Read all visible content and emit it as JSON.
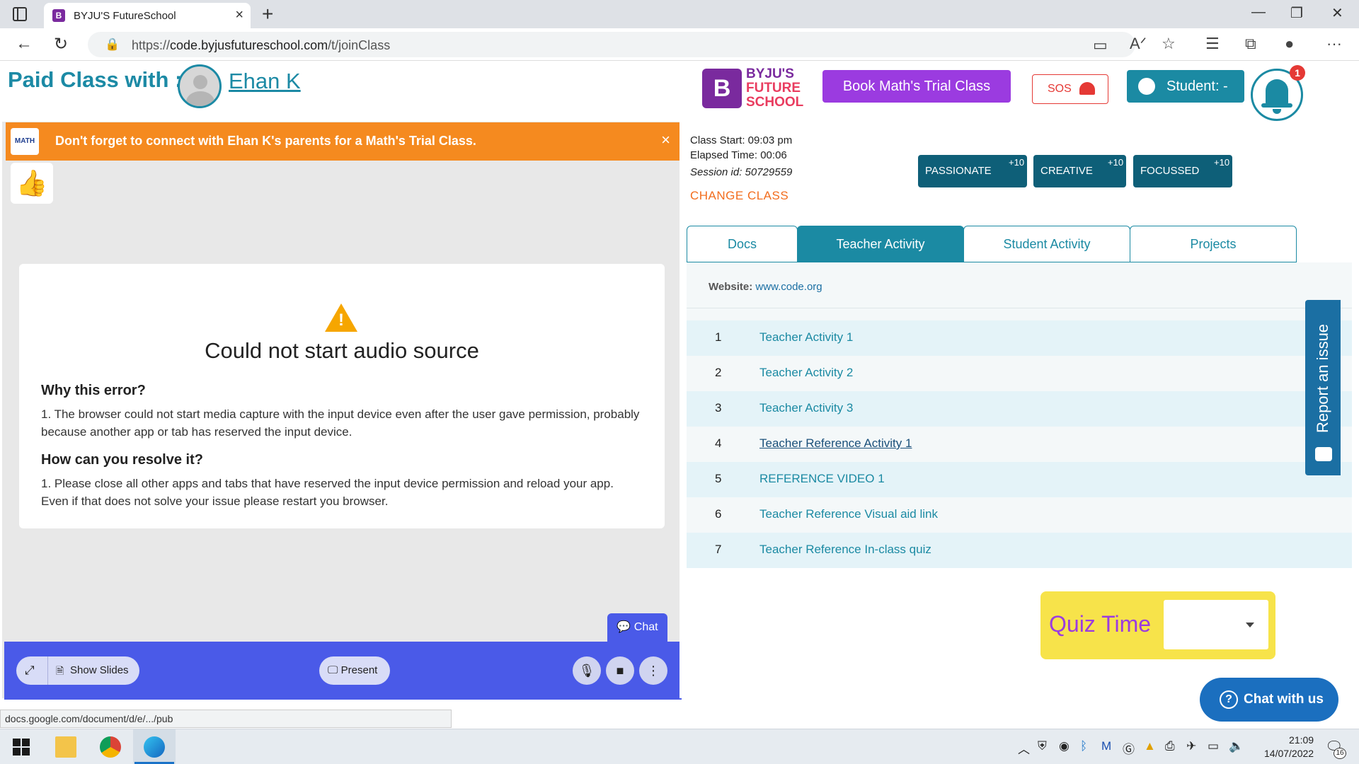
{
  "browser": {
    "tab_title": "BYJU'S FutureSchool",
    "tab_favicon_letter": "B",
    "tab_close": "×",
    "new_tab": "+",
    "url_scheme": "https://",
    "url_host": "code.byjusfutureschool.com",
    "url_path": "/t/joinClass",
    "status_url": "docs.google.com/document/d/e/.../pub"
  },
  "header": {
    "paid_class_label": "Paid Class with :",
    "student_name": "Ehan K",
    "logo_text_line1": "BYJU'S",
    "logo_text_line2": "FUTURE",
    "logo_text_line3": "SCHOOL",
    "logo_letter": "B",
    "book_trial_label": "Book Math's Trial Class",
    "sos_label": "SOS",
    "student_label": "Student: -",
    "notification_count": "1"
  },
  "banner": {
    "badge_text": "MATH",
    "message": "Don't forget to connect with Ehan K's parents for a Math's Trial Class.",
    "close": "×"
  },
  "reaction": "👍",
  "error_card": {
    "title": "Could not start audio source",
    "why_heading": "Why this error?",
    "why_text": "1. The browser could not start media capture with the input device even after the user gave permission, probably because another app or tab has reserved the input device.",
    "resolve_heading": "How can you resolve it?",
    "resolve_text": "1. Please close all other apps and tabs that have reserved the input device permission and reload your app. Even if that does not solve your issue please restart you browser."
  },
  "bottom_bar": {
    "chat_label": "Chat",
    "show_slides_label": "Show Slides",
    "present_label": "Present"
  },
  "class_info": {
    "class_start": "Class Start: 09:03 pm",
    "elapsed_time": "Elapsed Time: 00:06",
    "session_id": "Session id: 50729559",
    "change_class": "CHANGE CLASS"
  },
  "badges": [
    {
      "label": "PASSIONATE",
      "plus": "+10"
    },
    {
      "label": "CREATIVE",
      "plus": "+10"
    },
    {
      "label": "FOCUSSED",
      "plus": "+10"
    }
  ],
  "tabs": [
    {
      "label": "Docs",
      "active": false
    },
    {
      "label": "Teacher Activity",
      "active": true
    },
    {
      "label": "Student Activity",
      "active": false
    },
    {
      "label": "Projects",
      "active": false
    }
  ],
  "activity_panel": {
    "website_label": "Website:",
    "website_value": "www.code.org",
    "rows": [
      {
        "num": "1",
        "label": "Teacher Activity 1"
      },
      {
        "num": "2",
        "label": "Teacher Activity 2"
      },
      {
        "num": "3",
        "label": "Teacher Activity 3"
      },
      {
        "num": "4",
        "label": "Teacher Reference Activity 1"
      },
      {
        "num": "5",
        "label": "REFERENCE VIDEO 1"
      },
      {
        "num": "6",
        "label": "Teacher Reference Visual aid link"
      },
      {
        "num": "7",
        "label": "Teacher Reference In-class quiz"
      }
    ]
  },
  "report_issue": "Report an issue",
  "quiz": {
    "label": "Quiz Time",
    "selected": ""
  },
  "chat_with_us": "Chat with us",
  "taskbar": {
    "time": "21:09",
    "date": "14/07/2022",
    "notification_count": "16"
  },
  "colors": {
    "brand_teal": "#1b8aa3",
    "brand_purple": "#9b3be0",
    "banner_orange": "#f58a1f",
    "meeting_blue": "#4a5ae8",
    "quiz_yellow": "#f7e34a"
  }
}
